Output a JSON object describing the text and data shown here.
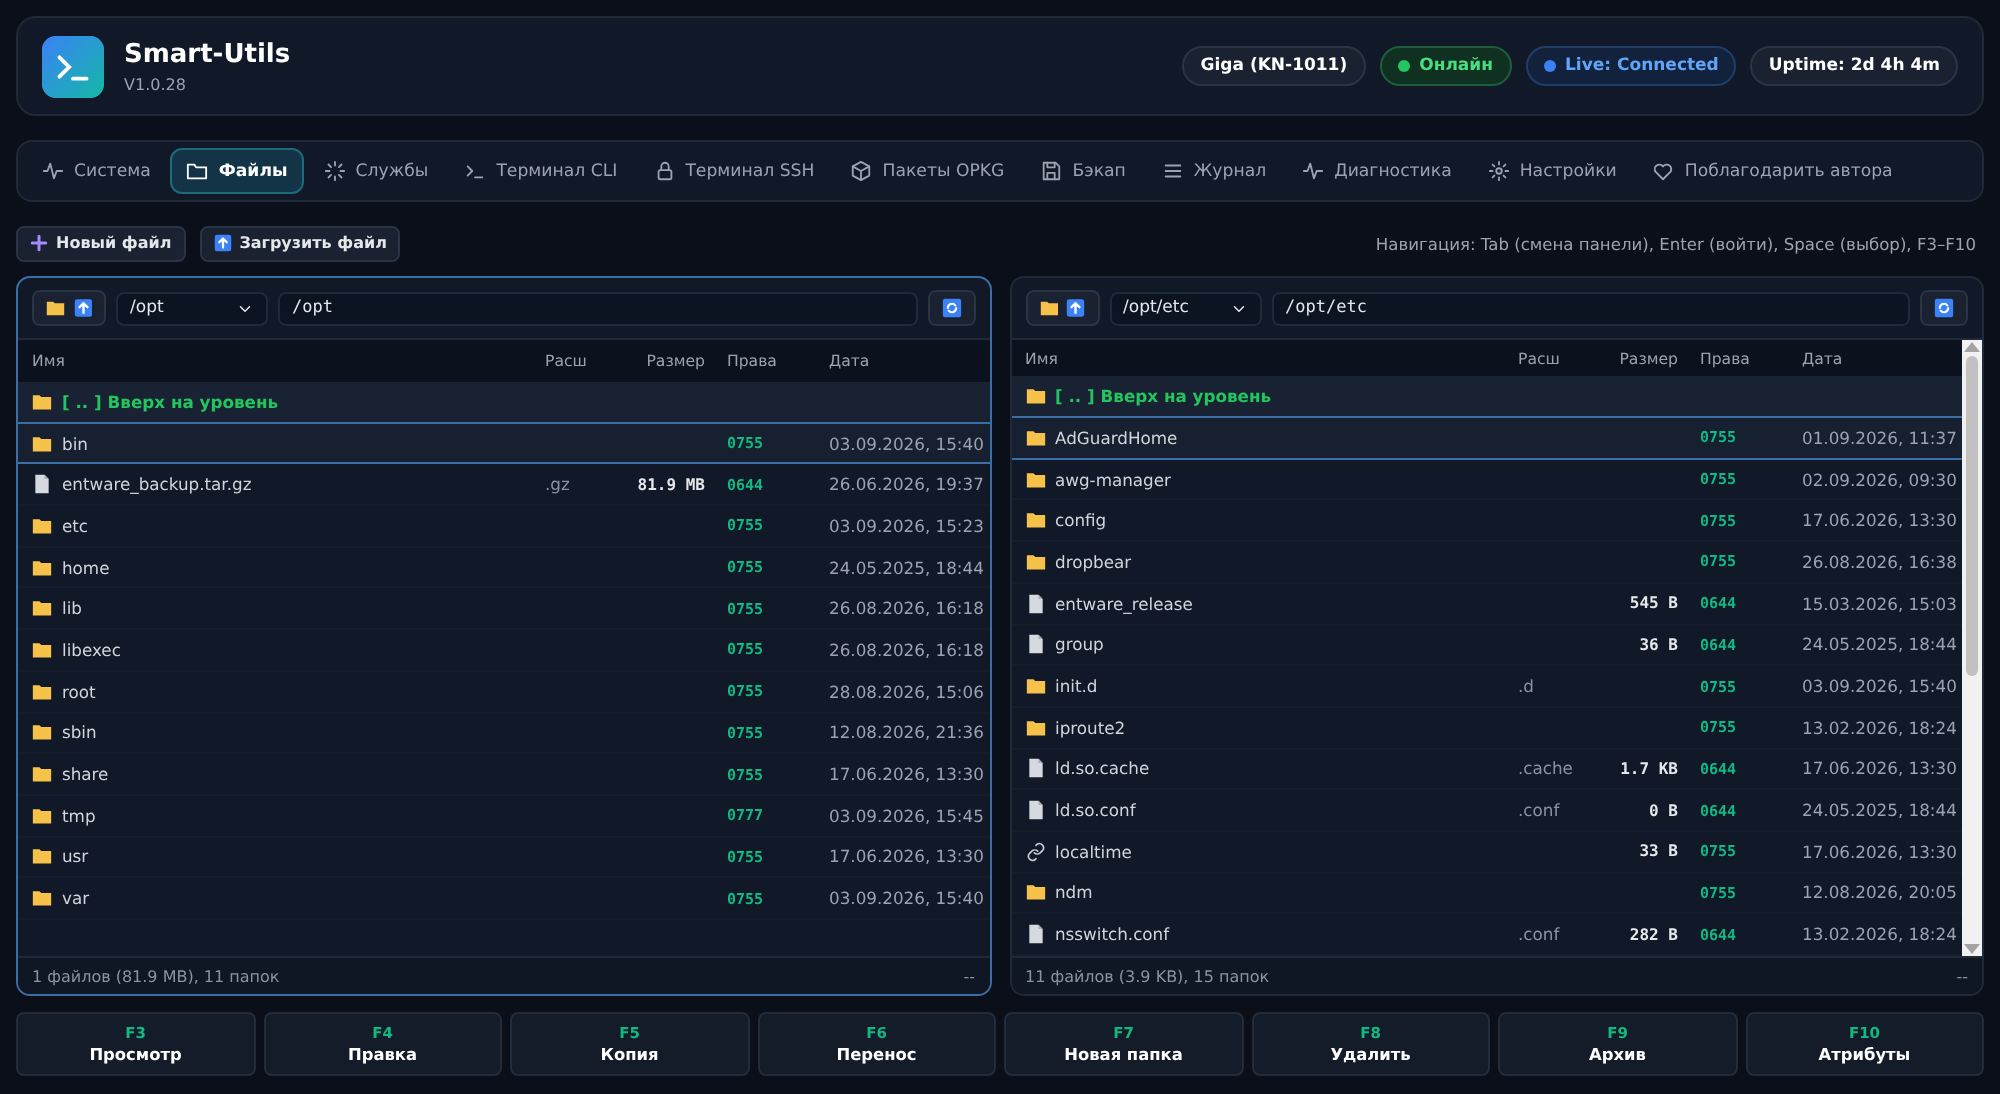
{
  "header": {
    "title": "Smart-Utils",
    "version": "V1.0.28",
    "badges": [
      {
        "kind": "device",
        "text": "Giga (KN-1011)"
      },
      {
        "kind": "online",
        "text": "Онлайн"
      },
      {
        "kind": "live",
        "text": "Live: Connected"
      },
      {
        "kind": "uptime",
        "text": "Uptime: 2d 4h 4m"
      }
    ]
  },
  "tabs": [
    {
      "label": "Система",
      "selected": false
    },
    {
      "label": "Файлы",
      "selected": true
    },
    {
      "label": "Службы",
      "selected": false
    },
    {
      "label": "Терминал CLI",
      "selected": false
    },
    {
      "label": "Терминал SSH",
      "selected": false
    },
    {
      "label": "Пакеты OPKG",
      "selected": false
    },
    {
      "label": "Бэкап",
      "selected": false
    },
    {
      "label": "Журнал",
      "selected": false
    },
    {
      "label": "Диагностика",
      "selected": false
    },
    {
      "label": "Настройки",
      "selected": false
    },
    {
      "label": "Поблагодарить автора",
      "selected": false
    }
  ],
  "toolbar": {
    "buttons": [
      {
        "kind": "new",
        "label": "Новый файл"
      },
      {
        "kind": "upload",
        "label": "Загрузить файл"
      }
    ],
    "hint": "Навигация: Tab (смена панели), Enter (войти), Space (выбор), F3–F10"
  },
  "panels": [
    {
      "active": true,
      "scrollable": false,
      "path_select": "/opt",
      "path_input": "/opt",
      "columns": [
        "Имя",
        "Расш",
        "Размер",
        "Права",
        "Дата"
      ],
      "up_label": "[ .. ] Вверх на уровень",
      "rows": [
        {
          "kind": "folder",
          "name": "bin",
          "ext": "",
          "size": "",
          "perm": "0755",
          "date": "03.09.2026, 15:40",
          "selected": true
        },
        {
          "kind": "file",
          "name": "entware_backup.tar.gz",
          "ext": ".gz",
          "size": "81.9 MB",
          "perm": "0644",
          "date": "26.06.2026, 19:37",
          "selected": false
        },
        {
          "kind": "folder",
          "name": "etc",
          "ext": "",
          "size": "",
          "perm": "0755",
          "date": "03.09.2026, 15:23",
          "selected": false
        },
        {
          "kind": "folder",
          "name": "home",
          "ext": "",
          "size": "",
          "perm": "0755",
          "date": "24.05.2025, 18:44",
          "selected": false
        },
        {
          "kind": "folder",
          "name": "lib",
          "ext": "",
          "size": "",
          "perm": "0755",
          "date": "26.08.2026, 16:18",
          "selected": false
        },
        {
          "kind": "folder",
          "name": "libexec",
          "ext": "",
          "size": "",
          "perm": "0755",
          "date": "26.08.2026, 16:18",
          "selected": false
        },
        {
          "kind": "folder",
          "name": "root",
          "ext": "",
          "size": "",
          "perm": "0755",
          "date": "28.08.2026, 15:06",
          "selected": false
        },
        {
          "kind": "folder",
          "name": "sbin",
          "ext": "",
          "size": "",
          "perm": "0755",
          "date": "12.08.2026, 21:36",
          "selected": false
        },
        {
          "kind": "folder",
          "name": "share",
          "ext": "",
          "size": "",
          "perm": "0755",
          "date": "17.06.2026, 13:30",
          "selected": false
        },
        {
          "kind": "folder",
          "name": "tmp",
          "ext": "",
          "size": "",
          "perm": "0777",
          "date": "03.09.2026, 15:45",
          "selected": false
        },
        {
          "kind": "folder",
          "name": "usr",
          "ext": "",
          "size": "",
          "perm": "0755",
          "date": "17.06.2026, 13:30",
          "selected": false
        },
        {
          "kind": "folder",
          "name": "var",
          "ext": "",
          "size": "",
          "perm": "0755",
          "date": "03.09.2026, 15:40",
          "selected": false
        }
      ],
      "status": "1 файлов (81.9 MB), 11 папок",
      "status_right": "--"
    },
    {
      "active": false,
      "scrollable": true,
      "path_select": "/opt/etc",
      "path_input": "/opt/etc",
      "columns": [
        "Имя",
        "Расш",
        "Размер",
        "Права",
        "Дата"
      ],
      "up_label": "[ .. ] Вверх на уровень",
      "rows": [
        {
          "kind": "folder",
          "name": "AdGuardHome",
          "ext": "",
          "size": "",
          "perm": "0755",
          "date": "01.09.2026, 11:37",
          "selected": true
        },
        {
          "kind": "folder",
          "name": "awg-manager",
          "ext": "",
          "size": "",
          "perm": "0755",
          "date": "02.09.2026, 09:30",
          "selected": false
        },
        {
          "kind": "folder",
          "name": "config",
          "ext": "",
          "size": "",
          "perm": "0755",
          "date": "17.06.2026, 13:30",
          "selected": false
        },
        {
          "kind": "folder",
          "name": "dropbear",
          "ext": "",
          "size": "",
          "perm": "0755",
          "date": "26.08.2026, 16:38",
          "selected": false
        },
        {
          "kind": "file",
          "name": "entware_release",
          "ext": "",
          "size": "545 B",
          "perm": "0644",
          "date": "15.03.2026, 15:03",
          "selected": false
        },
        {
          "kind": "file",
          "name": "group",
          "ext": "",
          "size": "36 B",
          "perm": "0644",
          "date": "24.05.2025, 18:44",
          "selected": false
        },
        {
          "kind": "folder",
          "name": "init.d",
          "ext": ".d",
          "size": "",
          "perm": "0755",
          "date": "03.09.2026, 15:40",
          "selected": false
        },
        {
          "kind": "folder",
          "name": "iproute2",
          "ext": "",
          "size": "",
          "perm": "0755",
          "date": "13.02.2026, 18:24",
          "selected": false
        },
        {
          "kind": "file",
          "name": "ld.so.cache",
          "ext": ".cache",
          "size": "1.7 KB",
          "perm": "0644",
          "date": "17.06.2026, 13:30",
          "selected": false
        },
        {
          "kind": "file",
          "name": "ld.so.conf",
          "ext": ".conf",
          "size": "0 B",
          "perm": "0644",
          "date": "24.05.2025, 18:44",
          "selected": false
        },
        {
          "kind": "link",
          "name": "localtime",
          "ext": "",
          "size": "33 B",
          "perm": "0755",
          "date": "17.06.2026, 13:30",
          "selected": false
        },
        {
          "kind": "folder",
          "name": "ndm",
          "ext": "",
          "size": "",
          "perm": "0755",
          "date": "12.08.2026, 20:05",
          "selected": false
        },
        {
          "kind": "file",
          "name": "nsswitch.conf",
          "ext": ".conf",
          "size": "282 B",
          "perm": "0644",
          "date": "13.02.2026, 18:24",
          "selected": false
        }
      ],
      "status": "11 файлов (3.9 KB), 15 папок",
      "status_right": "--"
    }
  ],
  "fkeys": [
    {
      "key": "F3",
      "label": "Просмотр"
    },
    {
      "key": "F4",
      "label": "Правка"
    },
    {
      "key": "F5",
      "label": "Копия"
    },
    {
      "key": "F6",
      "label": "Перенос"
    },
    {
      "key": "F7",
      "label": "Новая папка"
    },
    {
      "key": "F8",
      "label": "Удалить"
    },
    {
      "key": "F9",
      "label": "Архив"
    },
    {
      "key": "F10",
      "label": "Атрибуты"
    }
  ]
}
